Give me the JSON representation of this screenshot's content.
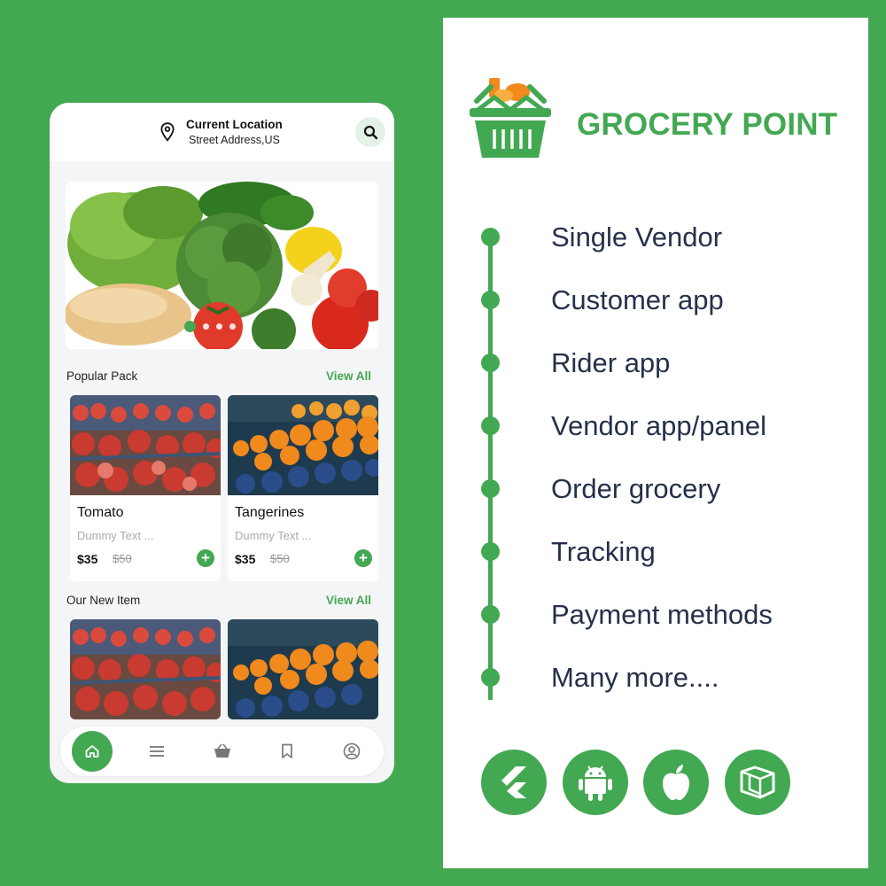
{
  "phone": {
    "header": {
      "location_title": "Current Location",
      "location_address": "Street Address,US",
      "location_icon": "map-pin-icon",
      "search_icon": "search-icon"
    },
    "banner": {
      "image": "fresh-vegetables-photo",
      "slide_count": 4,
      "active_slide": 1
    },
    "popular": {
      "title": "Popular Pack",
      "view_all": "View All",
      "items": [
        {
          "name": "Tomato",
          "desc": "Dummy Text ...",
          "price": "$35",
          "old_price": "$50",
          "image": "tomatoes-photo"
        },
        {
          "name": "Tangerines",
          "desc": "Dummy Text ...",
          "price": "$35",
          "old_price": "$50",
          "image": "tangerines-photo"
        }
      ]
    },
    "new_items": {
      "title": "Our New Item",
      "view_all": "View All",
      "items": [
        {
          "image": "tomatoes-photo"
        },
        {
          "image": "tangerines-photo"
        }
      ]
    },
    "bottom_nav": [
      {
        "icon": "home-icon",
        "active": true
      },
      {
        "icon": "menu-icon",
        "active": false
      },
      {
        "icon": "basket-icon",
        "active": false
      },
      {
        "icon": "bookmark-icon",
        "active": false
      },
      {
        "icon": "profile-icon",
        "active": false
      }
    ]
  },
  "panel": {
    "brand": "GROCERY POINT",
    "logo": "grocery-basket-logo",
    "features": [
      "Single Vendor",
      "Customer app",
      "Rider app",
      "Vendor app/panel",
      "Order grocery",
      "Tracking",
      "Payment methods",
      "Many more...."
    ],
    "platforms": [
      "flutter-icon",
      "android-icon",
      "apple-icon",
      "laravel-icon"
    ]
  },
  "colors": {
    "background": "#43a852",
    "accent": "#43a852",
    "text_dark": "#26304a",
    "panel": "#ffffff"
  }
}
